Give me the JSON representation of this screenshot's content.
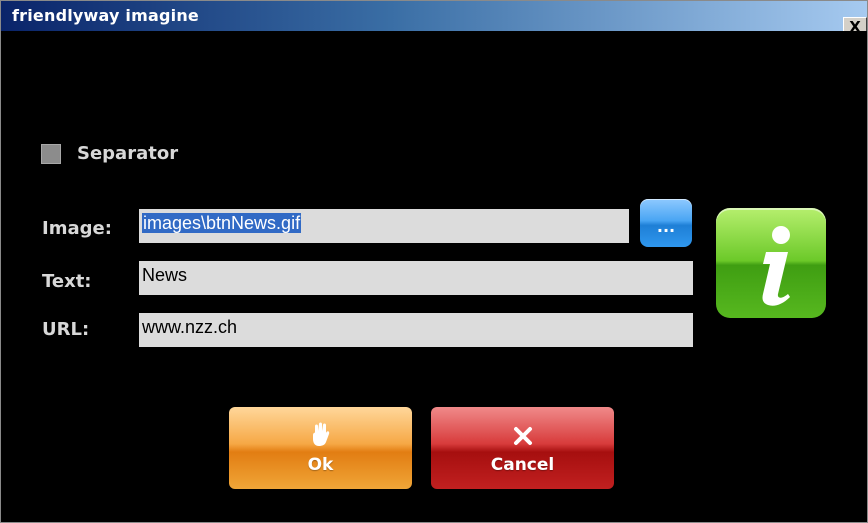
{
  "window": {
    "title": "friendlyway imagine",
    "close_label": "X"
  },
  "separator": {
    "label": "Separator",
    "checked": false
  },
  "form": {
    "image_label": "Image:",
    "image_value": "images\\btnNews.gif",
    "text_label": "Text:",
    "text_value": "News",
    "url_label": "URL:",
    "url_value": "www.nzz.ch",
    "browse_label": "..."
  },
  "buttons": {
    "ok_label": "Ok",
    "cancel_label": "Cancel"
  },
  "icons": {
    "info": "info-icon",
    "ok": "hand-icon",
    "cancel": "x-icon",
    "browse": "ellipsis-icon"
  },
  "colors": {
    "ok": "#f2a23a",
    "cancel": "#c41f1f",
    "browse": "#2f8fe8",
    "info": "#5dbb22"
  }
}
